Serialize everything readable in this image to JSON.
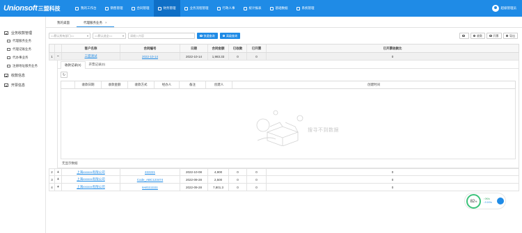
{
  "app": {
    "logo_en": "Unionsoft",
    "logo_cn": "三盟科技",
    "user": "超级管理员"
  },
  "nav": [
    "我的工作台",
    "销售管理",
    "合同管理",
    "财务管理",
    "业务流程管理",
    "行政人事",
    "统计报表",
    "基础数据",
    "系统管理"
  ],
  "sidebar": {
    "groups": [
      {
        "label": "业务收款管理",
        "items": [
          "代理服务业务",
          "代理记账业务",
          "代办事业务",
          "注册地址服务业务"
        ]
      },
      {
        "label": "收款信息",
        "items": []
      },
      {
        "label": "开票信息",
        "items": []
      }
    ]
  },
  "tabs": [
    {
      "label": "我的桌面"
    },
    {
      "label": "代理服务业务",
      "close": "×"
    }
  ],
  "filter": {
    "select1": "==默认所有部门==",
    "select2": "==默认选全==",
    "keyword_placeholder": "请输入内容",
    "btn_search": "快速查询",
    "btn_advanced": "高级查询"
  },
  "toolbar": [
    "",
    "收款",
    "开票",
    "导出"
  ],
  "table": {
    "headers": [
      "客户名称",
      "合同编号",
      "日期",
      "合同金额",
      "已收款",
      "已开票",
      "已开票收款比"
    ],
    "rows": [
      {
        "no": "1",
        "exp": "−",
        "cust": "三盟测试",
        "con": "2022-10-14",
        "date": "2022-10-14",
        "amt": "1,983.33",
        "rec": "0",
        "inv": "0",
        "ratio": "0"
      },
      {
        "no": "2",
        "exp": "+",
        "cust": "上海xxxxxx有限公司",
        "con": "222221",
        "date": "2022-10-08",
        "amt": "4,900",
        "rec": "0",
        "inv": "0",
        "ratio": "0"
      },
      {
        "no": "3",
        "exp": "+",
        "cust": "上海xxxxxx有限公司",
        "con": "Code_ABC123474",
        "date": "2022-09-28",
        "amt": "2,500",
        "rec": "0",
        "inv": "0",
        "ratio": "0"
      },
      {
        "no": "4",
        "exp": "+",
        "cust": "上海xxxxxx有限公司",
        "con": "test1111111",
        "date": "2022-09-28",
        "amt": "7,801.3",
        "rec": "0",
        "inv": "0",
        "ratio": "0"
      }
    ]
  },
  "detail": {
    "tabs": [
      "收款记录(0)",
      "开票记录(0)"
    ],
    "headers": [
      "收款日期",
      "收款金额",
      "收款方式",
      "经办人",
      "备注",
      "创建人",
      "创建时间"
    ],
    "empty": "搜寻不到数据",
    "nodata": "无显示数据"
  },
  "badge": {
    "percent": "82",
    "unit": "%",
    "line1": "↑0K/s",
    "line2": "↓0.1K/s"
  },
  "colors": {
    "primary": "#1f8be6",
    "nav_active": "#0f6fc6",
    "success": "#3bc27a"
  }
}
